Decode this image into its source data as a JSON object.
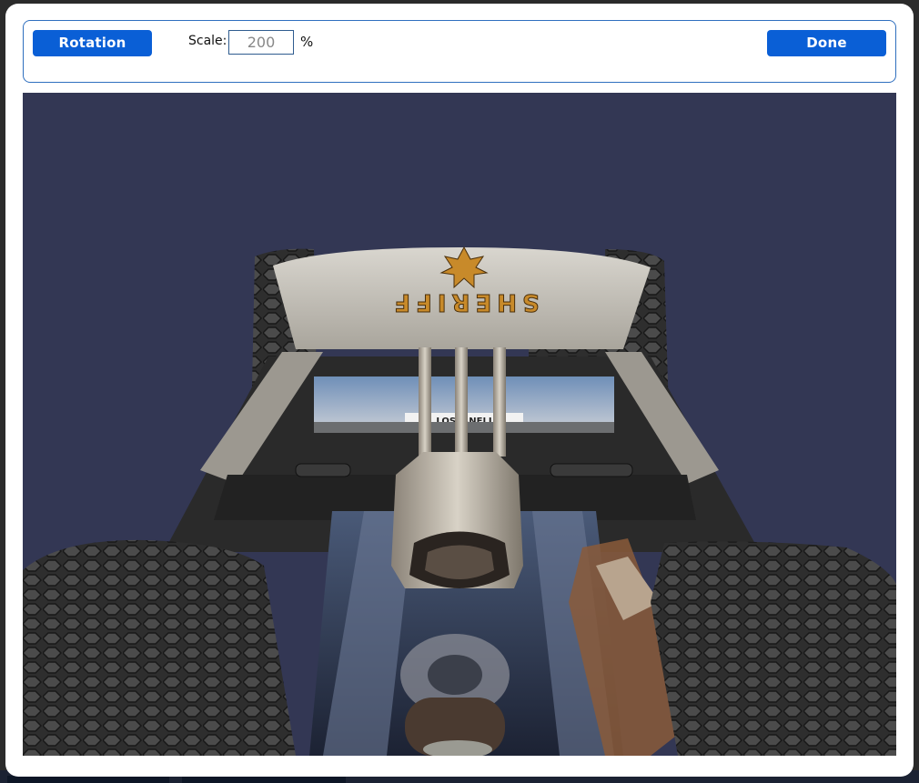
{
  "toolbar": {
    "rotation_label": "Rotation",
    "scale_label": "Scale:",
    "scale_value": "200",
    "scale_unit": "%",
    "done_label": "Done"
  },
  "viewport": {
    "background_color": "#333754",
    "model_text": "SHERIFF",
    "billboard_text": "LOSPANELI"
  },
  "colors": {
    "accent": "#0a5fd6",
    "toolbar_border": "#2f6fbf"
  }
}
